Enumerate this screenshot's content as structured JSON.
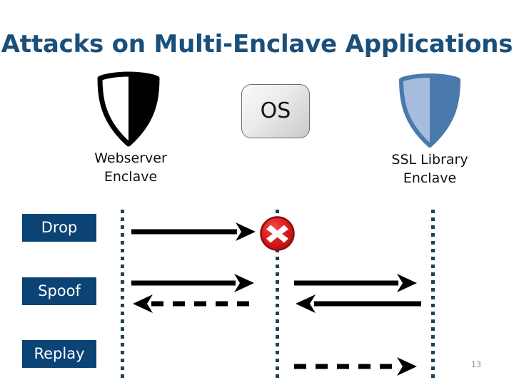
{
  "slide": {
    "title": "Attacks on Multi-Enclave Applications",
    "page_number": "13",
    "background_color": "#ffffff",
    "title_color": "#1a4f7a"
  },
  "entities": {
    "os": {
      "label": "OS",
      "icon": "rounded-square-os-box"
    },
    "webserver": {
      "caption_line1": "Webserver",
      "caption_line2": "Enclave",
      "icon": "shield-icon-black-white"
    },
    "ssl": {
      "caption_line1": "SSL Library",
      "caption_line2": "Enclave",
      "icon": "shield-icon-blue"
    }
  },
  "boundaries": {
    "count": 3,
    "style": "vertical-dotted",
    "color": "#1f4155"
  },
  "attacks": [
    {
      "id": "drop",
      "label": "Drop",
      "chip_color": "#0b4375",
      "text_color": "#ffffff"
    },
    {
      "id": "spoof",
      "label": "Spoof",
      "chip_color": "#0b4375",
      "text_color": "#ffffff"
    },
    {
      "id": "replay",
      "label": "Replay",
      "chip_color": "#0b4375",
      "text_color": "#ffffff"
    }
  ],
  "markers": {
    "blocked": {
      "icon": "x-circle-icon",
      "fill_color": "#e01b1b",
      "border_color": "#9e0f0f",
      "glyph_color": "#ffffff"
    }
  },
  "arrows": {
    "drop_left_to_os": {
      "direction": "right",
      "style": "solid",
      "color": "#000000"
    },
    "spoof_left_top": {
      "direction": "right",
      "style": "solid",
      "color": "#000000"
    },
    "spoof_left_bottom": {
      "direction": "left",
      "style": "dashed",
      "color": "#000000"
    },
    "spoof_right_top": {
      "direction": "right",
      "style": "solid",
      "color": "#000000"
    },
    "spoof_right_bottom": {
      "direction": "left",
      "style": "solid",
      "color": "#000000"
    },
    "replay_right": {
      "direction": "right",
      "style": "dashed",
      "color": "#000000"
    }
  }
}
